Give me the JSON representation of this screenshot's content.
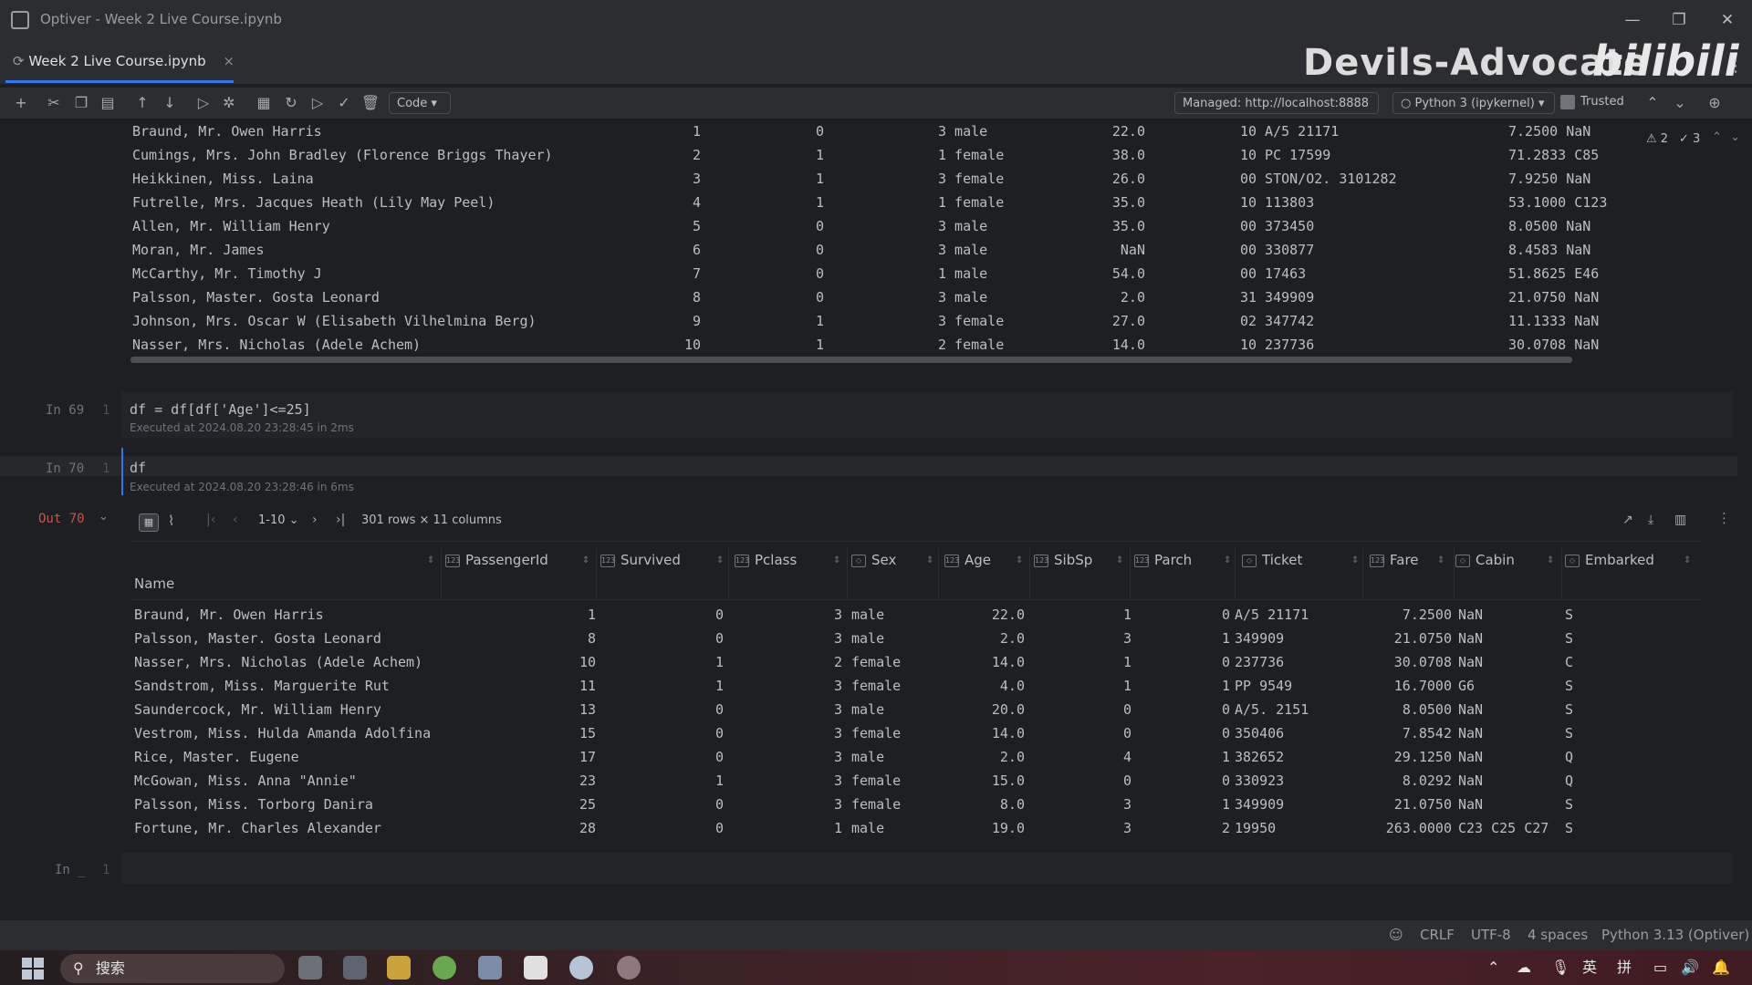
{
  "window": {
    "title": "Optiver - Week 2 Live Course.ipynb",
    "min": "—",
    "restore": "❐",
    "close": "✕"
  },
  "tab": {
    "label": "Week 2 Live Course.ipynb",
    "close": "×"
  },
  "watermark": {
    "text": "Devils-Advocate",
    "logo": "bilibili"
  },
  "toolbar": {
    "cell_type": "Code",
    "server": "Managed: http://localhost:8888",
    "kernel": "Python 3 (ipykernel)",
    "trusted": "Trusted",
    "warnings": "⚠ 2",
    "checks": "✓ 3"
  },
  "prev_output": {
    "rows": [
      [
        "Braund, Mr. Owen Harris",
        "1",
        "0",
        "3 male",
        "22.0",
        "1",
        "0 A/5 21171",
        "7.2500 NaN"
      ],
      [
        "Cumings, Mrs. John Bradley (Florence Briggs Thayer)",
        "2",
        "1",
        "1 female",
        "38.0",
        "1",
        "0 PC 17599",
        "71.2833 C85"
      ],
      [
        "Heikkinen, Miss. Laina",
        "3",
        "1",
        "3 female",
        "26.0",
        "0",
        "0 STON/O2. 3101282",
        "7.9250 NaN"
      ],
      [
        "Futrelle, Mrs. Jacques Heath (Lily May Peel)",
        "4",
        "1",
        "1 female",
        "35.0",
        "1",
        "0 113803",
        "53.1000 C123"
      ],
      [
        "Allen, Mr. William Henry",
        "5",
        "0",
        "3 male",
        "35.0",
        "0",
        "0 373450",
        "8.0500 NaN"
      ],
      [
        "Moran, Mr. James",
        "6",
        "0",
        "3 male",
        "NaN",
        "0",
        "0 330877",
        "8.4583 NaN"
      ],
      [
        "McCarthy, Mr. Timothy J",
        "7",
        "0",
        "1 male",
        "54.0",
        "0",
        "0 17463",
        "51.8625 E46"
      ],
      [
        "Palsson, Master. Gosta Leonard",
        "8",
        "0",
        "3 male",
        "2.0",
        "3",
        "1 349909",
        "21.0750 NaN"
      ],
      [
        "Johnson, Mrs. Oscar W (Elisabeth Vilhelmina Berg)",
        "9",
        "1",
        "3 female",
        "27.0",
        "0",
        "2 347742",
        "11.1333 NaN"
      ],
      [
        "Nasser, Mrs. Nicholas (Adele Achem)",
        "10",
        "1",
        "2 female",
        "14.0",
        "1",
        "0 237736",
        "30.0708 NaN"
      ]
    ]
  },
  "cell69": {
    "prompt": "In 69",
    "line": "1",
    "code": "df = df[df['Age']<=25]",
    "exec": "Executed at 2024.08.20 23:28:45 in 2ms"
  },
  "cell70": {
    "prompt": "In 70",
    "line": "1",
    "code": "df",
    "exec": "Executed at 2024.08.20 23:28:46 in 6ms"
  },
  "out70": {
    "prompt": "Out 70",
    "pager": "1-10",
    "summary": "301 rows × 11 columns",
    "index_header": "Name",
    "columns": [
      "PassengerId",
      "Survived",
      "Pclass",
      "Sex",
      "Age",
      "SibSp",
      "Parch",
      "Ticket",
      "Fare",
      "Cabin",
      "Embarked"
    ],
    "rows": [
      [
        "Braund, Mr. Owen Harris",
        "1",
        "0",
        "3",
        "male",
        "22.0",
        "1",
        "0",
        "A/5 21171",
        "7.2500",
        "NaN",
        "S"
      ],
      [
        "Palsson, Master. Gosta Leonard",
        "8",
        "0",
        "3",
        "male",
        "2.0",
        "3",
        "1",
        "349909",
        "21.0750",
        "NaN",
        "S"
      ],
      [
        "Nasser, Mrs. Nicholas (Adele Achem)",
        "10",
        "1",
        "2",
        "female",
        "14.0",
        "1",
        "0",
        "237736",
        "30.0708",
        "NaN",
        "C"
      ],
      [
        "Sandstrom, Miss. Marguerite Rut",
        "11",
        "1",
        "3",
        "female",
        "4.0",
        "1",
        "1",
        "PP 9549",
        "16.7000",
        "G6",
        "S"
      ],
      [
        "Saundercock, Mr. William Henry",
        "13",
        "0",
        "3",
        "male",
        "20.0",
        "0",
        "0",
        "A/5. 2151",
        "8.0500",
        "NaN",
        "S"
      ],
      [
        "Vestrom, Miss. Hulda Amanda Adolfina",
        "15",
        "0",
        "3",
        "female",
        "14.0",
        "0",
        "0",
        "350406",
        "7.8542",
        "NaN",
        "S"
      ],
      [
        "Rice, Master. Eugene",
        "17",
        "0",
        "3",
        "male",
        "2.0",
        "4",
        "1",
        "382652",
        "29.1250",
        "NaN",
        "Q"
      ],
      [
        "McGowan, Miss. Anna \"Annie\"",
        "23",
        "1",
        "3",
        "female",
        "15.0",
        "0",
        "0",
        "330923",
        "8.0292",
        "NaN",
        "Q"
      ],
      [
        "Palsson, Miss. Torborg Danira",
        "25",
        "0",
        "3",
        "female",
        "8.0",
        "3",
        "1",
        "349909",
        "21.0750",
        "NaN",
        "S"
      ],
      [
        "Fortune, Mr. Charles Alexander",
        "28",
        "0",
        "1",
        "male",
        "19.0",
        "3",
        "2",
        "19950",
        "263.0000",
        "C23 C25 C27",
        "S"
      ]
    ]
  },
  "next_cell": {
    "prompt": "In _",
    "line": "1"
  },
  "statusbar": {
    "line_sep": "CRLF",
    "encoding": "UTF-8",
    "indent": "4 spaces",
    "interpreter": "Python 3.13 (Optiver)"
  },
  "taskbar": {
    "search_placeholder": "搜索",
    "ime1": "英",
    "ime2": "拼"
  }
}
